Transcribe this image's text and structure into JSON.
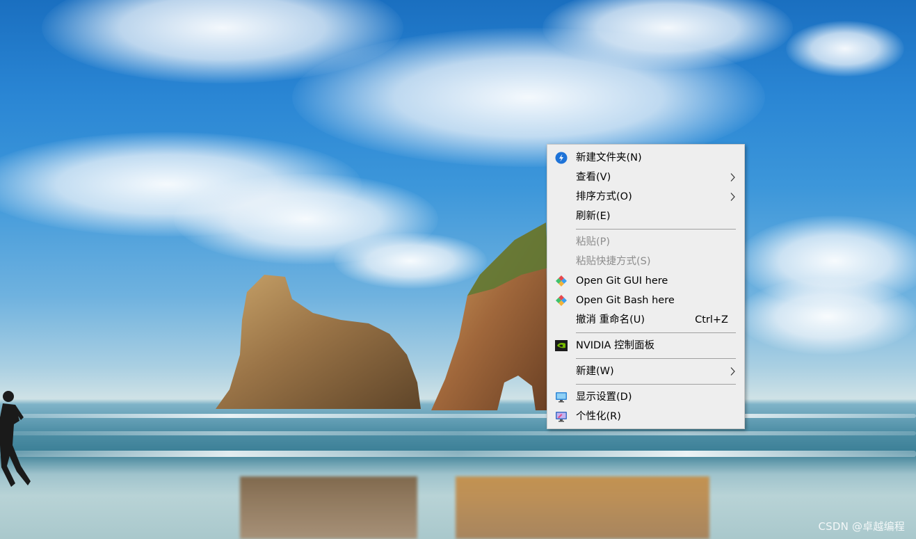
{
  "desktop": {
    "watermark": "CSDN @卓越编程"
  },
  "context_menu": {
    "items": [
      {
        "label": "新建文件夹(N)",
        "icon": "new-folder-icon",
        "enabled": true
      },
      {
        "label": "查看(V)",
        "submenu": true,
        "enabled": true
      },
      {
        "label": "排序方式(O)",
        "submenu": true,
        "enabled": true
      },
      {
        "label": "刷新(E)",
        "enabled": true
      },
      {
        "label": "粘贴(P)",
        "enabled": false
      },
      {
        "label": "粘贴快捷方式(S)",
        "enabled": false
      },
      {
        "label": "Open Git GUI here",
        "icon": "git-gui-icon",
        "enabled": true
      },
      {
        "label": "Open Git Bash here",
        "icon": "git-bash-icon",
        "enabled": true
      },
      {
        "label": "撤消 重命名(U)",
        "shortcut": "Ctrl+Z",
        "enabled": true
      },
      {
        "label": "NVIDIA 控制面板",
        "icon": "nvidia-icon",
        "enabled": true
      },
      {
        "label": "新建(W)",
        "submenu": true,
        "enabled": true
      },
      {
        "label": "显示设置(D)",
        "icon": "display-settings-icon",
        "enabled": true
      },
      {
        "label": "个性化(R)",
        "icon": "personalize-icon",
        "enabled": true
      }
    ]
  },
  "colors": {
    "menu_background": "#eeeeee",
    "disabled_text": "#8c8c8c",
    "separator": "#a0a0a0"
  }
}
